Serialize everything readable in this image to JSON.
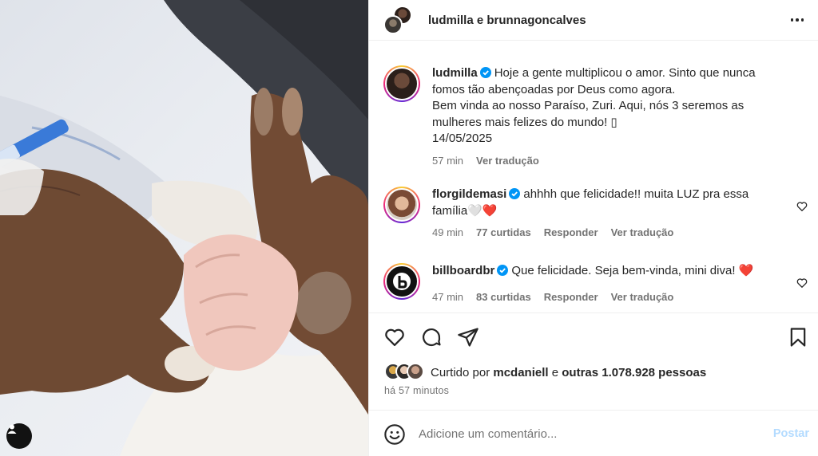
{
  "header": {
    "user1": "ludmilla",
    "joiner": "e",
    "user2": "brunnagoncalves"
  },
  "caption": {
    "username": "ludmilla",
    "text": "Hoje a gente multiplicou o amor. Sinto que nunca fomos tão abençoadas por Deus como agora.",
    "line2": "Bem vinda ao nosso Paraíso, Zuri. Aqui, nós 3 seremos as mulheres mais felizes do mundo! ▯",
    "date": "14/05/2025",
    "time": "57 min",
    "translate": "Ver tradução"
  },
  "comments": [
    {
      "username": "florgildemasi",
      "text": "ahhhh que felicidade!! muita LUZ pra essa família",
      "emoji": "🤍❤️",
      "time": "49 min",
      "likes": "77 curtidas",
      "reply": "Responder",
      "translate": "Ver tradução"
    },
    {
      "username": "billboardbr",
      "text": "Que felicidade. Seja bem-vinda, mini diva!",
      "emoji": "❤️",
      "time": "47 min",
      "likes": "83 curtidas",
      "reply": "Responder",
      "translate": "Ver tradução"
    }
  ],
  "likes": {
    "prefix": "Curtido por",
    "user": "mcdaniell",
    "joiner": "e",
    "others": "outras 1.078.928 pessoas"
  },
  "posted": "há 57 minutos",
  "add_comment": {
    "placeholder": "Adicione um comentário...",
    "post_label": "Postar"
  },
  "icons": {
    "more": "more-horizontal-icon",
    "like": "heart-icon",
    "comment": "comment-bubble-icon",
    "share": "paper-plane-icon",
    "save": "bookmark-icon",
    "emoji": "smiley-icon",
    "user_tag": "user-tag-icon"
  },
  "colors": {
    "verified": "#0095f6",
    "text_primary": "#262626",
    "text_secondary": "#737373",
    "post_disabled": "#b3dbff",
    "heart_red": "#ed1d24"
  }
}
